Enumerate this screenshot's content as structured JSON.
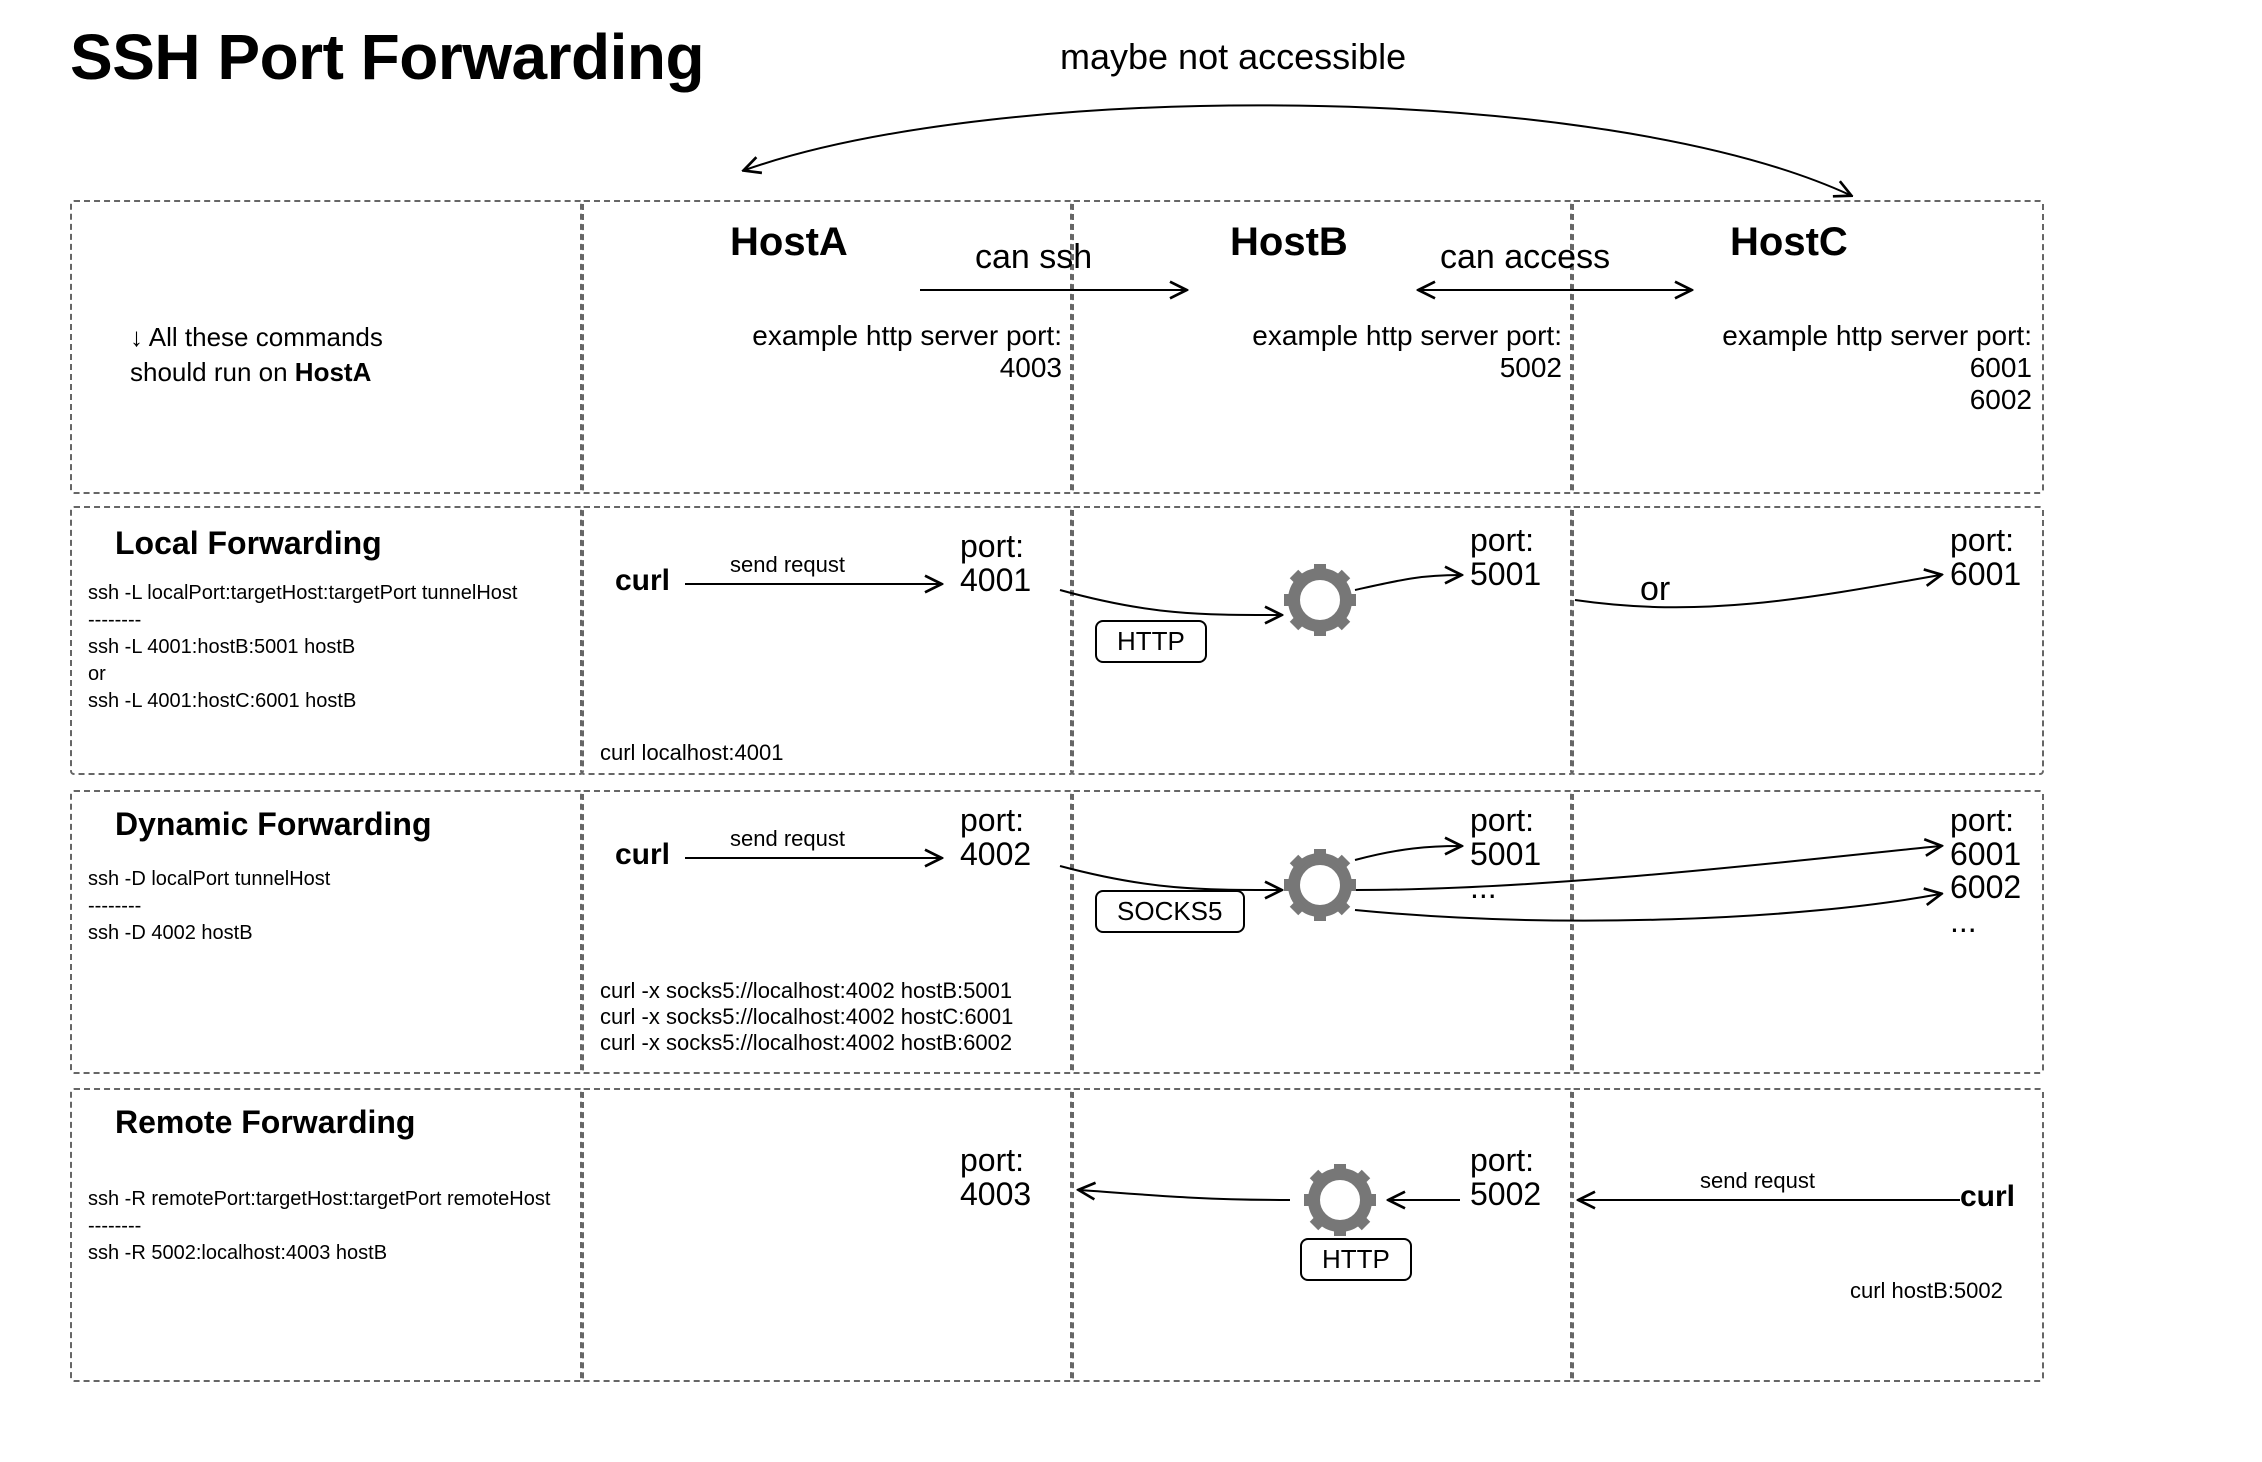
{
  "title": "SSH Port Forwarding",
  "top_note": "maybe not accessible",
  "left_note_line1": "↓  All these commands",
  "left_note_line2": "should run on ",
  "left_note_bold": "HostA",
  "hosts": {
    "A": {
      "name": "HostA",
      "port_desc": "example http server port:\n4003"
    },
    "B": {
      "name": "HostB",
      "port_desc": "example http server port:\n5002"
    },
    "C": {
      "name": "HostC",
      "port_desc": "example http server port:\n6001\n6002"
    }
  },
  "rel": {
    "ab": "can ssh",
    "bc": "can access"
  },
  "local": {
    "title": "Local Forwarding",
    "cmds": "ssh -L localPort:targetHost:targetPort tunnelHost\n--------\nssh -L 4001:hostB:5001 hostB\nor\nssh -L 4001:hostC:6001 hostB",
    "curl": "curl",
    "send": "send requst",
    "portA": "port:\n4001",
    "proto": "HTTP",
    "portB": "port:\n5001",
    "or": "or",
    "portC": "port:\n6001",
    "curl_cmd": "curl localhost:4001"
  },
  "dynamic": {
    "title": "Dynamic Forwarding",
    "cmds": "ssh -D localPort tunnelHost\n--------\nssh -D 4002 hostB",
    "curl": "curl",
    "send": "send requst",
    "portA": "port:\n4002",
    "proto": "SOCKS5",
    "portB": "port:\n5001\n...",
    "portC": "port:\n6001\n6002\n...",
    "curl_cmd": "curl -x socks5://localhost:4002 hostB:5001\ncurl -x socks5://localhost:4002 hostC:6001\ncurl -x socks5://localhost:4002 hostB:6002"
  },
  "remote": {
    "title": "Remote Forwarding",
    "cmds": "ssh -R remotePort:targetHost:targetPort remoteHost\n--------\nssh -R 5002:localhost:4003 hostB",
    "portA": "port:\n4003",
    "proto": "HTTP",
    "portB": "port:\n5002",
    "send": "send requst",
    "curl": "curl",
    "curl_cmd": "curl hostB:5002"
  }
}
